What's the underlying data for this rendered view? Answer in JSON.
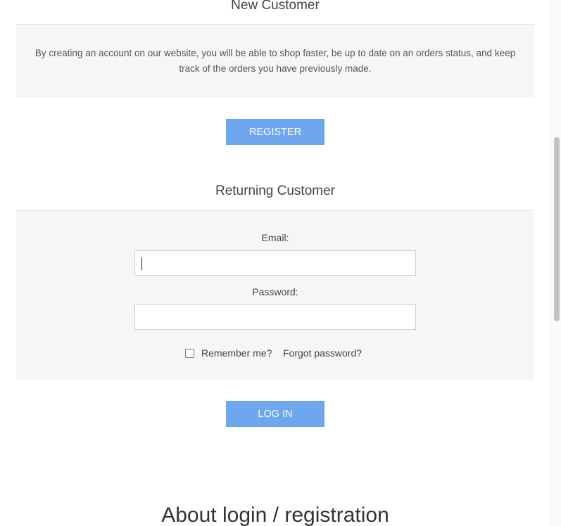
{
  "new_customer": {
    "title": "New Customer",
    "text": "By creating an account on our website, you will be able to shop faster, be up to date on an orders status, and keep track of the orders you have previously made.",
    "register_label": "REGISTER"
  },
  "returning_customer": {
    "title": "Returning Customer",
    "email_label": "Email:",
    "email_value": "",
    "password_label": "Password:",
    "password_value": "",
    "remember_label": "Remember me?",
    "remember_checked": false,
    "forgot_label": "Forgot password?",
    "login_label": "LOG IN"
  },
  "about": {
    "title": "About login / registration"
  },
  "colors": {
    "button": "#6ea7ee",
    "panel": "#f6f6f6",
    "text": "#444444"
  }
}
